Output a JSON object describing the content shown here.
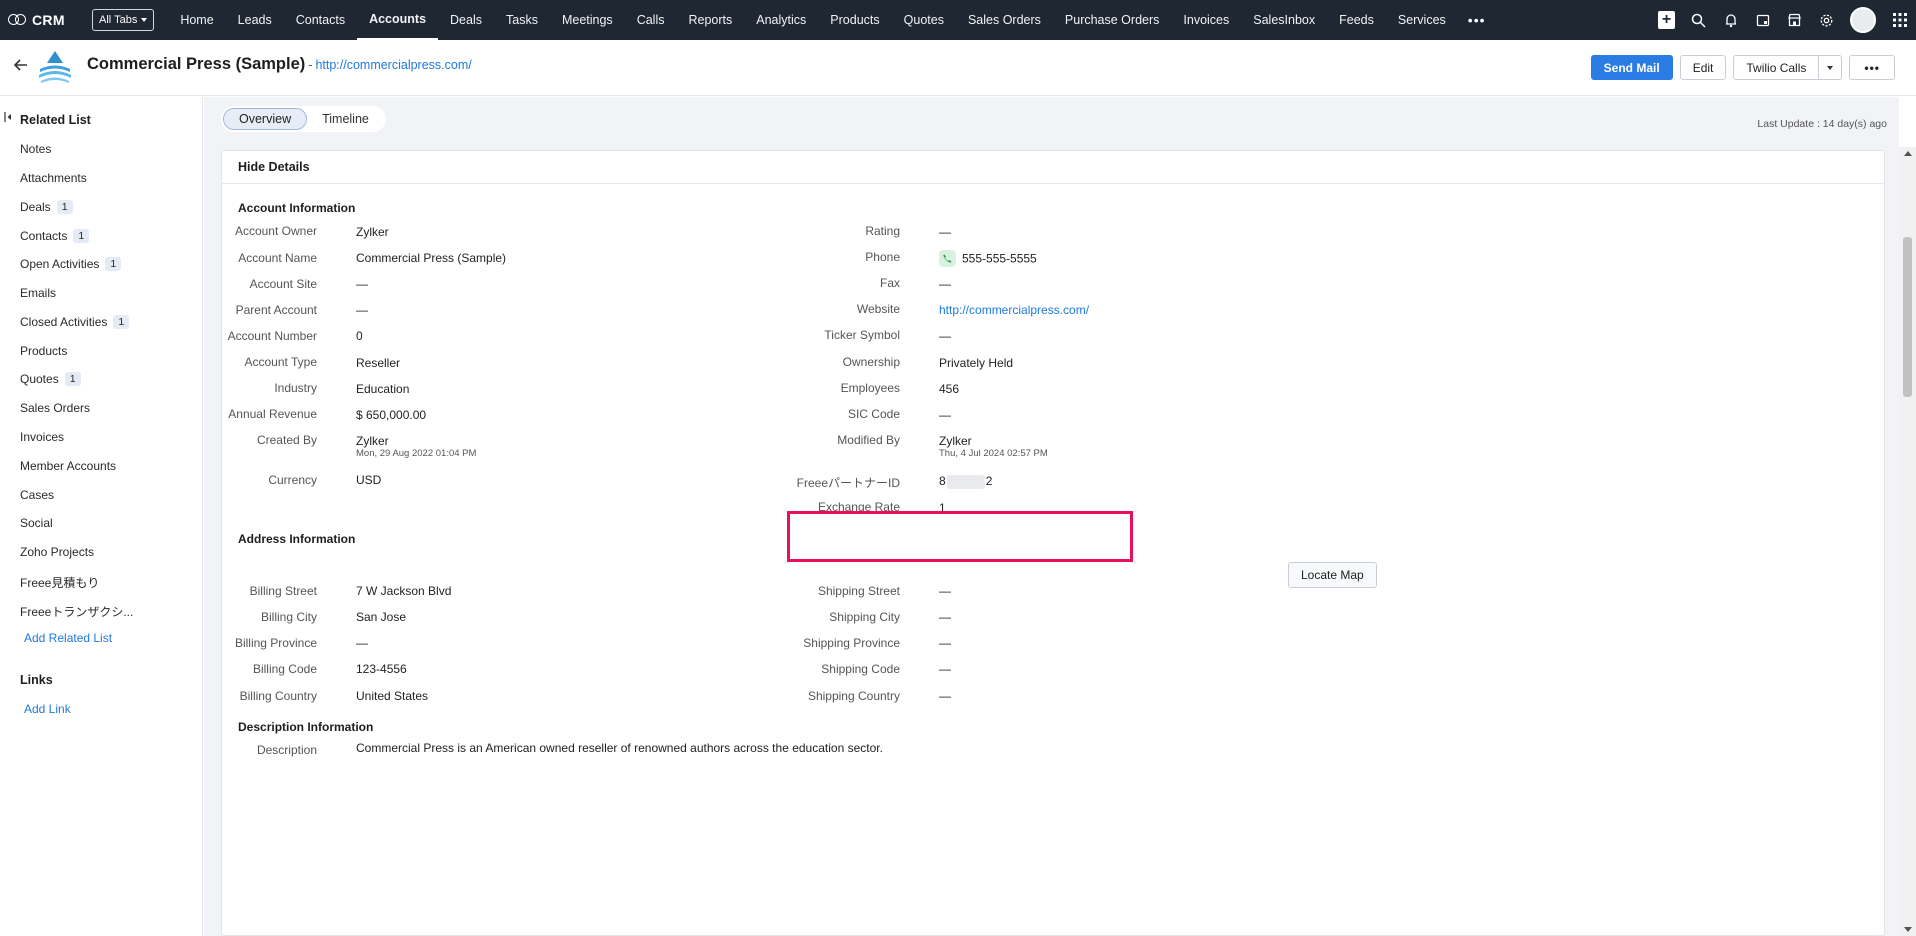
{
  "nav": {
    "logo_text": "CRM",
    "all_tabs": "All Tabs",
    "tabs": [
      "Home",
      "Leads",
      "Contacts",
      "Accounts",
      "Deals",
      "Tasks",
      "Meetings",
      "Calls",
      "Reports",
      "Analytics",
      "Products",
      "Quotes",
      "Sales Orders",
      "Purchase Orders",
      "Invoices",
      "SalesInbox",
      "Feeds",
      "Services"
    ],
    "active_tab": "Accounts",
    "more": "•••",
    "add": "+"
  },
  "header": {
    "title": "Commercial Press (Sample)",
    "separator": "-",
    "url": "http://commercialpress.com/",
    "send_mail": "Send Mail",
    "edit": "Edit",
    "twilio": "Twilio Calls",
    "more": "•••"
  },
  "sidebar": {
    "related_list": "Related List",
    "items": [
      {
        "label": "Notes",
        "count": ""
      },
      {
        "label": "Attachments",
        "count": ""
      },
      {
        "label": "Deals",
        "count": "1"
      },
      {
        "label": "Contacts",
        "count": "1"
      },
      {
        "label": "Open Activities",
        "count": "1"
      },
      {
        "label": "Emails",
        "count": ""
      },
      {
        "label": "Closed Activities",
        "count": "1"
      },
      {
        "label": "Products",
        "count": ""
      },
      {
        "label": "Quotes",
        "count": "1"
      },
      {
        "label": "Sales Orders",
        "count": ""
      },
      {
        "label": "Invoices",
        "count": ""
      },
      {
        "label": "Member Accounts",
        "count": ""
      },
      {
        "label": "Cases",
        "count": ""
      },
      {
        "label": "Social",
        "count": ""
      },
      {
        "label": "Zoho Projects",
        "count": ""
      },
      {
        "label": "Freee見積もり",
        "count": ""
      },
      {
        "label": "Freeeトランザクシ...",
        "count": ""
      }
    ],
    "add_related_list": "Add Related List",
    "links": "Links",
    "add_link": "Add Link"
  },
  "content": {
    "tabs": [
      "Overview",
      "Timeline"
    ],
    "last_update": "Last Update : 14 day(s) ago",
    "hide_details": "Hide Details",
    "account_info_title": "Account Information",
    "left_fields": [
      {
        "label": "Account Owner",
        "value": "Zylker"
      },
      {
        "label": "Account Name",
        "value": "Commercial Press (Sample)"
      },
      {
        "label": "Account Site",
        "value": "—"
      },
      {
        "label": "Parent Account",
        "value": "—"
      },
      {
        "label": "Account Number",
        "value": "0"
      },
      {
        "label": "Account Type",
        "value": "Reseller"
      },
      {
        "label": "Industry",
        "value": "Education"
      },
      {
        "label": "Annual Revenue",
        "value": "$ 650,000.00"
      },
      {
        "label": "Created By",
        "value": "Zylker",
        "sub": "Mon, 29 Aug 2022 01:04 PM"
      },
      {
        "label": "Currency",
        "value": "USD"
      }
    ],
    "right_fields": [
      {
        "label": "Rating",
        "value": "—"
      },
      {
        "label": "Phone",
        "value": "555-555-5555"
      },
      {
        "label": "Fax",
        "value": "—"
      },
      {
        "label": "Website",
        "value": "http://commercialpress.com/"
      },
      {
        "label": "Ticker Symbol",
        "value": "—"
      },
      {
        "label": "Ownership",
        "value": "Privately Held"
      },
      {
        "label": "Employees",
        "value": "456"
      },
      {
        "label": "SIC Code",
        "value": "—"
      },
      {
        "label": "Modified By",
        "value": "Zylker",
        "sub": "Thu, 4 Jul 2024 02:57 PM"
      },
      {
        "label": "FreeeパートナーID",
        "value_start": "8",
        "value_end": "2"
      },
      {
        "label": "Exchange Rate",
        "value": "1"
      }
    ],
    "address_title": "Address Information",
    "locate_map": "Locate Map",
    "address_left": [
      {
        "label": "Billing Street",
        "value": "7 W Jackson Blvd"
      },
      {
        "label": "Billing City",
        "value": "San Jose"
      },
      {
        "label": "Billing Province",
        "value": "—"
      },
      {
        "label": "Billing Code",
        "value": "123-4556"
      },
      {
        "label": "Billing Country",
        "value": "United States"
      }
    ],
    "address_right": [
      {
        "label": "Shipping Street",
        "value": "—"
      },
      {
        "label": "Shipping City",
        "value": "—"
      },
      {
        "label": "Shipping Province",
        "value": "—"
      },
      {
        "label": "Shipping Code",
        "value": "—"
      },
      {
        "label": "Shipping Country",
        "value": "—"
      }
    ],
    "description_title": "Description Information",
    "description_label": "Description",
    "description_value": "Commercial Press is an American owned reseller of renowned authors across the education sector."
  },
  "colors": {
    "nav_bg": "#1f2733",
    "accent": "#2b7be5",
    "link": "#1f79e0",
    "highlight": "#e8105a"
  }
}
